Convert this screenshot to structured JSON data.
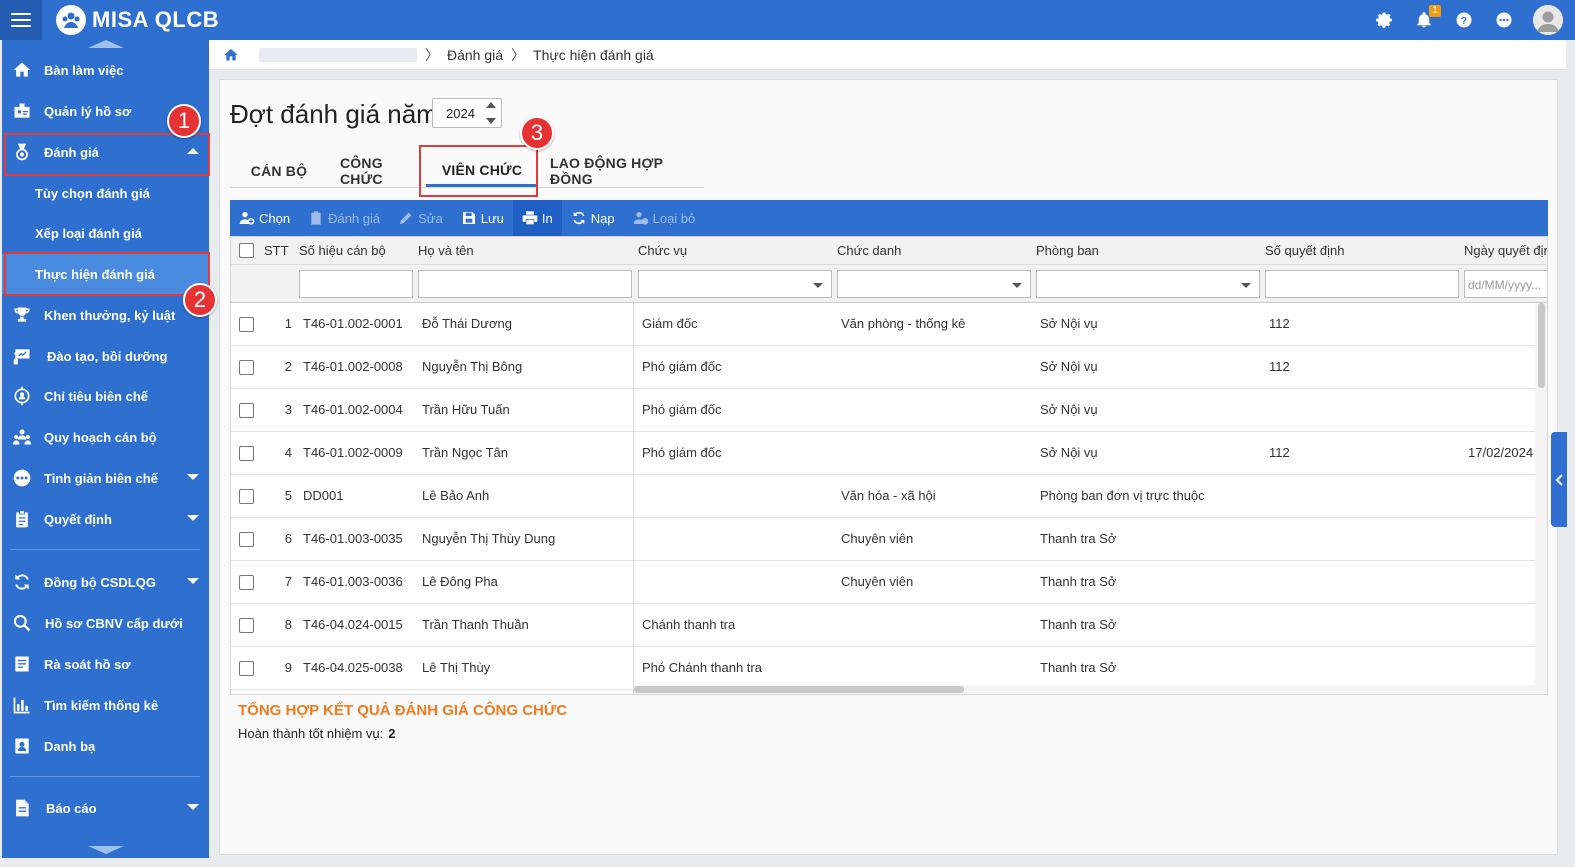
{
  "app": {
    "title": "MISA QLCB"
  },
  "topbar": {
    "notification_count": "1"
  },
  "sidebar": {
    "items": [
      {
        "label": "Bàn làm việc",
        "icon": "home-icon"
      },
      {
        "label": "Quản lý hồ sơ",
        "icon": "id-card-icon"
      },
      {
        "label": "Đánh giá",
        "icon": "medal-icon"
      },
      {
        "label": "Khen thưởng, kỷ luật",
        "icon": "trophy-icon"
      },
      {
        "label": "Đào tạo, bồi dưỡng",
        "icon": "presentation-icon"
      },
      {
        "label": "Chỉ tiêu biên chế",
        "icon": "target-icon"
      },
      {
        "label": "Quy hoạch cán bộ",
        "icon": "group-icon"
      },
      {
        "label": "Tinh giản biên chế",
        "icon": "more-circle-icon"
      },
      {
        "label": "Quyết định",
        "icon": "clipboard-icon"
      },
      {
        "label": "Đồng bộ CSDLQG",
        "icon": "sync-icon"
      },
      {
        "label": "Hồ sơ CBNV cấp dưới",
        "icon": "search-icon"
      },
      {
        "label": "Rà soát hồ sơ",
        "icon": "document-check-icon"
      },
      {
        "label": "Tìm kiếm thống kê",
        "icon": "bar-chart-icon"
      },
      {
        "label": "Danh bạ",
        "icon": "contacts-icon"
      },
      {
        "label": "Báo cáo",
        "icon": "report-icon"
      }
    ],
    "sub_items": [
      {
        "label": "Tùy chọn đánh giá"
      },
      {
        "label": "Xếp loại đánh giá"
      },
      {
        "label": "Thực hiện đánh giá"
      }
    ]
  },
  "callouts": [
    "1",
    "2",
    "3"
  ],
  "breadcrumb": {
    "item1": "Đánh giá",
    "item2": "Thực hiện đánh giá"
  },
  "page": {
    "title": "Đợt đánh giá năm",
    "year": "2024"
  },
  "tabs": [
    {
      "label": "CÁN BỘ"
    },
    {
      "label": "CÔNG CHỨC"
    },
    {
      "label": "VIÊN CHỨC"
    },
    {
      "label": "LAO ĐỘNG HỢP ĐỒNG"
    }
  ],
  "toolbar": {
    "choose": "Chọn",
    "evaluate": "Đánh giá",
    "edit": "Sửa",
    "save": "Lưu",
    "print": "In",
    "reload": "Nạp",
    "remove": "Loại bỏ"
  },
  "table": {
    "headers": {
      "stt": "STT",
      "code": "Số hiệu cán bộ",
      "name": "Họ và tên",
      "position": "Chức vụ",
      "title": "Chức danh",
      "department": "Phòng ban",
      "decision_no": "Số quyết định",
      "decision_date": "Ngày quyết định"
    },
    "date_placeholder": "dd/MM/yyyy...",
    "rows": [
      {
        "stt": "1",
        "code": "T46-01.002-0001",
        "name": "Đỗ Thái Dương",
        "position": "Giám đốc",
        "title": "Văn phòng - thống kê",
        "department": "Sở Nội vụ",
        "decision_no": "112",
        "decision_date": ""
      },
      {
        "stt": "2",
        "code": "T46-01.002-0008",
        "name": "Nguyễn Thị Bông",
        "position": "Phó giám đốc",
        "title": "",
        "department": "Sở Nội vụ",
        "decision_no": "112",
        "decision_date": ""
      },
      {
        "stt": "3",
        "code": "T46-01.002-0004",
        "name": "Trần Hữu Tuấn",
        "position": "Phó giám đốc",
        "title": "",
        "department": "Sở Nội vụ",
        "decision_no": "",
        "decision_date": ""
      },
      {
        "stt": "4",
        "code": "T46-01.002-0009",
        "name": "Trần Ngọc Tân",
        "position": "Phó giám đốc",
        "title": "",
        "department": "Sở Nội vụ",
        "decision_no": "112",
        "decision_date": "17/02/2024"
      },
      {
        "stt": "5",
        "code": "DD001",
        "name": "Lê Bảo Anh",
        "position": "",
        "title": "Văn hóa - xã hội",
        "department": "Phòng ban đơn vị trực thuộc",
        "decision_no": "",
        "decision_date": ""
      },
      {
        "stt": "6",
        "code": "T46-01.003-0035",
        "name": "Nguyễn Thị Thùy Dung",
        "position": "",
        "title": "Chuyên viên",
        "department": "Thanh tra Sở",
        "decision_no": "",
        "decision_date": ""
      },
      {
        "stt": "7",
        "code": "T46-01.003-0036",
        "name": "Lê Đông Pha",
        "position": "",
        "title": "Chuyên viên",
        "department": "Thanh tra Sở",
        "decision_no": "",
        "decision_date": ""
      },
      {
        "stt": "8",
        "code": "T46-04.024-0015",
        "name": "Trần Thanh Thuần",
        "position": "Chánh thanh tra",
        "title": "",
        "department": "Thanh tra Sở",
        "decision_no": "",
        "decision_date": ""
      },
      {
        "stt": "9",
        "code": "T46-04.025-0038",
        "name": "Lê Thị Thùy",
        "position": "Phó Chánh thanh tra",
        "title": "",
        "department": "Thanh tra Sở",
        "decision_no": "",
        "decision_date": ""
      }
    ]
  },
  "summary": {
    "title": "TỔNG HỢP KẾT QUẢ ĐÁNH GIÁ CÔNG CHỨC",
    "label": "Hoàn thành tốt nhiệm vụ:",
    "value": "2"
  },
  "colors": {
    "primary": "#2e6fd0",
    "callout": "#e63232",
    "summary_title": "#f07a1d"
  }
}
